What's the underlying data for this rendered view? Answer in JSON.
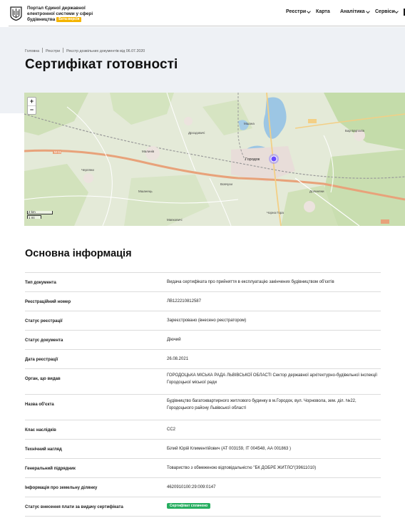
{
  "header": {
    "portal_line1": "Портал Єдиної державної",
    "portal_line2": "електронної системи у сфері",
    "portal_line3": "будівництва",
    "beta_label": "Бета-версія",
    "nav": [
      "Реєстри",
      "Карта",
      "Аналітика",
      "Сервіси"
    ]
  },
  "breadcrumb": {
    "home": "Головна",
    "registries": "Реєстри",
    "current": "Реєстр дозвільних документів від 06.07.2020"
  },
  "page_title": "Сертифікат готовності",
  "map": {
    "zoom_in": "+",
    "zoom_out": "−",
    "scale_km": "2 km",
    "scale_mi": "1 mi",
    "road_label": "M-11",
    "town_label": "Городок",
    "place_labels": [
      "Зимна Вода",
      "Малинів",
      "Дроздовичі",
      "Мшана",
      "Черляни",
      "Вовчухи",
      "Чорна Гора",
      "Тулигловы",
      "Велика Калинівка",
      "Бар Бартатів",
      "Мшанець",
      "Мавковичі",
      "Долиняни"
    ]
  },
  "section": {
    "title": "Основна інформація",
    "rows": [
      {
        "label": "Тип документа",
        "value": "Видача сертифіката про прийняття в експлуатацію закінчених будівництвом об'єктів"
      },
      {
        "label": "Реєстраційний номер",
        "value": "ЛВ122210812587"
      },
      {
        "label": "Статус реєстрації",
        "value": "Зареєстровано (внесено реєстратором)"
      },
      {
        "label": "Статус документа",
        "value": "Діючий"
      },
      {
        "label": "Дата реєстрації",
        "value": "26.08.2021"
      },
      {
        "label": "Орган, що видав",
        "value": "ГОРОДОЦЬКА МІСЬКА РАДА ЛЬВІВСЬКОЇ ОБЛАСТІ Сектор державної архітектурно-будівельної інспекції Городоцької міської ради"
      },
      {
        "label": "Назва об'єкта",
        "value": "Будівництво багатоквартирного житлового будинку в м.Городок, вул. Чорновола, зем. діл. №22, Городоцького району Львівської області"
      },
      {
        "label": "Клас наслідків",
        "value": "СС2"
      },
      {
        "label": "Технічний нагляд",
        "value": "Білий Юрій Климентійович (АТ 003159, ІТ 004548, АА 001863 )"
      },
      {
        "label": "Генеральний підрядник",
        "value": "Товариство з обмеженою відповідальністю \"БК ДОБРЕ ЖИТЛО\"(39611010)"
      },
      {
        "label": "Інформація про земельну ділянку",
        "value": "4620910100:29:009:0147"
      },
      {
        "label": "Статус внесення плати за видачу сертифіката",
        "value": "Сертифікат сплачено"
      }
    ]
  },
  "colors": {
    "accent_beta": "#f4b400",
    "status_paid": "#27ae60",
    "hero_bg": "#eef1f5",
    "map_marker": "#6a4cff"
  }
}
